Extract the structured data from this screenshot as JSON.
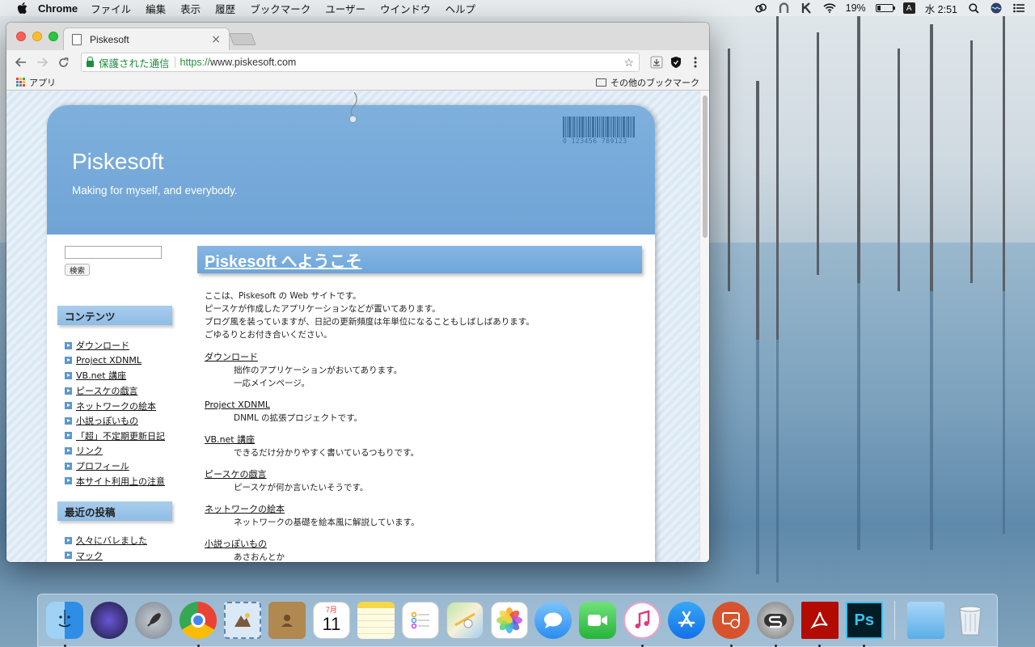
{
  "menubar": {
    "app_name": "Chrome",
    "items": [
      "ファイル",
      "編集",
      "表示",
      "履歴",
      "ブックマーク",
      "ユーザー",
      "ウインドウ",
      "ヘルプ"
    ],
    "battery": "19%",
    "battery_level": 0.19,
    "input_indicator": "A",
    "clock": "水 2:51"
  },
  "browser": {
    "tab_title": "Piskesoft",
    "tab_close": "×",
    "secure_label": "保護された通信",
    "url_scheme": "https://",
    "url_host": "www.piskesoft.com",
    "bookmark_apps": "アプリ",
    "bookmark_other": "その他のブックマーク"
  },
  "site": {
    "title": "Piskesoft",
    "tagline": "Making for myself, and everybody.",
    "barcode_number": "0 123456 789123",
    "search_button": "検索",
    "sidebar": {
      "contents_heading": "コンテンツ",
      "contents": [
        "ダウンロード",
        "Project XDNML",
        "VB.net 講座",
        "ピースケの戯言",
        "ネットワークの絵本",
        "小説っぽいもの",
        "「超」不定期更新日記",
        "リンク",
        "プロフィール",
        "本サイト利用上の注意"
      ],
      "recent_heading": "最近の投稿",
      "recent": [
        "久々にバレました",
        "マック"
      ]
    },
    "welcome": "Piskesoft へようこそ",
    "intro": [
      "ここは、Piskesoft の Web サイトです。",
      "ピースケが作成したアプリケーションなどが置いてあります。",
      "ブログ風を装っていますが、日記の更新頻度は年単位になることもしばしばあります。",
      "ごゆるりとお付き合いください。"
    ],
    "entries": [
      {
        "title": "ダウンロード",
        "desc1": "拙作のアプリケーションがおいてあります。",
        "desc2": "一応メインページ。"
      },
      {
        "title": "Project XDNML",
        "desc1": "DNML の拡張プロジェクトです。",
        "desc2": ""
      },
      {
        "title": "VB.net 講座",
        "desc1": "できるだけ分かりやすく書いているつもりです。",
        "desc2": ""
      },
      {
        "title": "ピースケの戯言",
        "desc1": "ピースケが何か言いたいそうです。",
        "desc2": ""
      },
      {
        "title": "ネットワークの絵本",
        "desc1": "ネットワークの基礎を絵本風に解説しています。",
        "desc2": ""
      },
      {
        "title": "小説っぽいもの",
        "desc1": "あさおんとか",
        "desc2": ""
      }
    ]
  },
  "dock": {
    "calendar_month": "7月",
    "calendar_day": "11",
    "ps_label": "Ps"
  },
  "colors": {
    "header_blue": "#6fa4d6",
    "secure_green": "#1e8e3e"
  }
}
